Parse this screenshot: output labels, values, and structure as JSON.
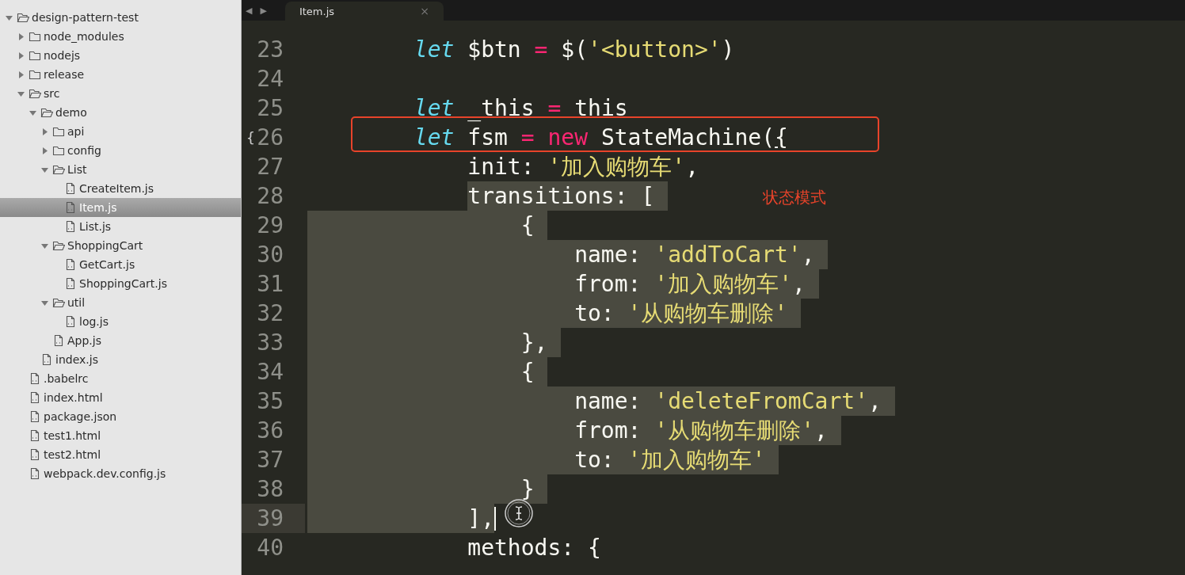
{
  "sidebar": {
    "tree": [
      {
        "kind": "folder",
        "name": "design-pattern-test",
        "expanded": true,
        "selected": false,
        "children": [
          {
            "kind": "folder",
            "name": "node_modules",
            "expanded": false,
            "selected": false
          },
          {
            "kind": "folder",
            "name": "nodejs",
            "expanded": false,
            "selected": false
          },
          {
            "kind": "folder",
            "name": "release",
            "expanded": false,
            "selected": false
          },
          {
            "kind": "folder",
            "name": "src",
            "expanded": true,
            "selected": false,
            "children": [
              {
                "kind": "folder",
                "name": "demo",
                "expanded": true,
                "selected": false,
                "children": [
                  {
                    "kind": "folder",
                    "name": "api",
                    "expanded": false,
                    "selected": false
                  },
                  {
                    "kind": "folder",
                    "name": "config",
                    "expanded": false,
                    "selected": false
                  },
                  {
                    "kind": "folder",
                    "name": "List",
                    "expanded": true,
                    "selected": false,
                    "children": [
                      {
                        "kind": "file",
                        "name": "CreateItem.js",
                        "selected": false
                      },
                      {
                        "kind": "file",
                        "name": "Item.js",
                        "selected": true
                      },
                      {
                        "kind": "file",
                        "name": "List.js",
                        "selected": false
                      }
                    ]
                  },
                  {
                    "kind": "folder",
                    "name": "ShoppingCart",
                    "expanded": true,
                    "selected": false,
                    "children": [
                      {
                        "kind": "file",
                        "name": "GetCart.js",
                        "selected": false
                      },
                      {
                        "kind": "file",
                        "name": "ShoppingCart.js",
                        "selected": false
                      }
                    ]
                  },
                  {
                    "kind": "folder",
                    "name": "util",
                    "expanded": true,
                    "selected": false,
                    "children": [
                      {
                        "kind": "file",
                        "name": "log.js",
                        "selected": false
                      }
                    ]
                  },
                  {
                    "kind": "file",
                    "name": "App.js",
                    "selected": false
                  }
                ]
              },
              {
                "kind": "file",
                "name": "index.js",
                "selected": false
              }
            ]
          },
          {
            "kind": "file",
            "name": ".babelrc",
            "selected": false
          },
          {
            "kind": "file",
            "name": "index.html",
            "selected": false
          },
          {
            "kind": "file",
            "name": "package.json",
            "selected": false
          },
          {
            "kind": "file",
            "name": "test1.html",
            "selected": false
          },
          {
            "kind": "file",
            "name": "test2.html",
            "selected": false
          },
          {
            "kind": "file",
            "name": "webpack.dev.config.js",
            "selected": false
          }
        ]
      }
    ]
  },
  "tab_bar": {
    "nav": [
      "◀",
      "▶"
    ],
    "tabs": [
      {
        "label": "Item.js",
        "close": "×",
        "selected": true
      }
    ]
  },
  "editor": {
    "lines": [
      {
        "number": "23",
        "selected": false,
        "tokens": [
          {
            "kind": "keyword",
            "text": "        let"
          },
          {
            "kind": "plain",
            "text": " $btn "
          },
          {
            "kind": "operator",
            "text": "="
          },
          {
            "kind": "plain",
            "text": " $("
          },
          {
            "kind": "string",
            "text": "'<button>'"
          },
          {
            "kind": "plain",
            "text": ")"
          }
        ]
      },
      {
        "number": "24",
        "selected": false
      },
      {
        "number": "25",
        "selected": false,
        "tokens": [
          {
            "kind": "keyword",
            "text": "        let"
          },
          {
            "kind": "plain",
            "text": " _this "
          },
          {
            "kind": "operator",
            "text": "="
          },
          {
            "kind": "plain",
            "text": " this"
          }
        ]
      },
      {
        "number": "26",
        "selected": false,
        "boxed": true,
        "gutter_mark": "{",
        "tokens": [
          {
            "kind": "keyword",
            "text": "        let"
          },
          {
            "kind": "plain",
            "text": " fsm "
          },
          {
            "kind": "operator",
            "text": "="
          },
          {
            "kind": "operator",
            "text": " new"
          },
          {
            "kind": "plain",
            "text": " StateMachine("
          },
          {
            "kind": "matched",
            "text": "{"
          }
        ]
      },
      {
        "number": "27",
        "selected": false,
        "tokens": [
          {
            "kind": "plain",
            "text": "            init: "
          },
          {
            "kind": "string",
            "text": "'加入购物车'"
          },
          {
            "kind": "plain",
            "text": ","
          }
        ]
      },
      {
        "number": "28",
        "selected": true,
        "tokens": [
          {
            "kind": "plain",
            "text": "            transitions: ["
          }
        ]
      },
      {
        "number": "29",
        "selected": true,
        "tokens": [
          {
            "kind": "plain",
            "text": "                {"
          }
        ]
      },
      {
        "number": "30",
        "selected": true,
        "tokens": [
          {
            "kind": "plain",
            "text": "                    name: "
          },
          {
            "kind": "string",
            "text": "'addToCart'"
          },
          {
            "kind": "plain",
            "text": ","
          }
        ]
      },
      {
        "number": "31",
        "selected": true,
        "tokens": [
          {
            "kind": "plain",
            "text": "                    from: "
          },
          {
            "kind": "string",
            "text": "'加入购物车'"
          },
          {
            "kind": "plain",
            "text": ","
          }
        ]
      },
      {
        "number": "32",
        "selected": true,
        "tokens": [
          {
            "kind": "plain",
            "text": "                    to: "
          },
          {
            "kind": "string",
            "text": "'从购物车删除'"
          }
        ]
      },
      {
        "number": "33",
        "selected": true,
        "tokens": [
          {
            "kind": "plain",
            "text": "                },"
          }
        ]
      },
      {
        "number": "34",
        "selected": true,
        "tokens": [
          {
            "kind": "plain",
            "text": "                {"
          }
        ]
      },
      {
        "number": "35",
        "selected": true,
        "tokens": [
          {
            "kind": "plain",
            "text": "                    name: "
          },
          {
            "kind": "string",
            "text": "'deleteFromCart'"
          },
          {
            "kind": "plain",
            "text": ","
          }
        ]
      },
      {
        "number": "36",
        "selected": true,
        "tokens": [
          {
            "kind": "plain",
            "text": "                    from: "
          },
          {
            "kind": "string",
            "text": "'从购物车删除'"
          },
          {
            "kind": "plain",
            "text": ","
          }
        ]
      },
      {
        "number": "37",
        "selected": true,
        "tokens": [
          {
            "kind": "plain",
            "text": "                    to: "
          },
          {
            "kind": "string",
            "text": "'加入购物车'"
          }
        ]
      },
      {
        "number": "38",
        "selected": true,
        "tokens": [
          {
            "kind": "plain",
            "text": "                }"
          }
        ]
      },
      {
        "number": "39",
        "selected": true,
        "current": true,
        "tokens": [
          {
            "kind": "plain",
            "text": "            ],"
          }
        ]
      },
      {
        "number": "40",
        "selected": false,
        "tokens": [
          {
            "kind": "plain",
            "text": "            methods: {"
          }
        ]
      }
    ],
    "annotation": {
      "text": "状态模式"
    }
  }
}
